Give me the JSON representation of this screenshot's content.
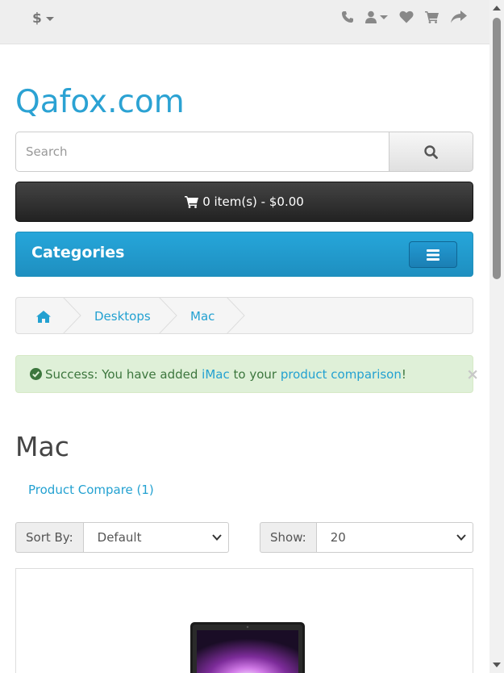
{
  "topbar": {
    "currency_symbol": "$",
    "icons": [
      "phone-icon",
      "user-icon",
      "heart-icon",
      "cart-icon",
      "share-icon"
    ]
  },
  "logo": {
    "text": "Qafox.com",
    "color": "#2ba2d3"
  },
  "search": {
    "placeholder": "Search",
    "value": ""
  },
  "cart": {
    "label": "0 item(s) - $0.00"
  },
  "categories": {
    "label": "Categories"
  },
  "breadcrumb": {
    "items": [
      {
        "label": "Desktops"
      },
      {
        "label": "Mac"
      }
    ]
  },
  "alert": {
    "prefix": "Success: You have added ",
    "product_link": "iMac",
    "middle": " to your ",
    "comparison_link": "product comparison",
    "suffix": "!",
    "close": "×"
  },
  "page": {
    "heading": "Mac",
    "compare_link": "Product Compare (1)"
  },
  "sort": {
    "label": "Sort By:",
    "value": "Default"
  },
  "show": {
    "label": "Show:",
    "value": "20"
  },
  "colors": {
    "accent": "#23a1d1",
    "categories_bg": "#229fd5",
    "success_bg": "#dff0d8",
    "success_text": "#3c763d"
  }
}
